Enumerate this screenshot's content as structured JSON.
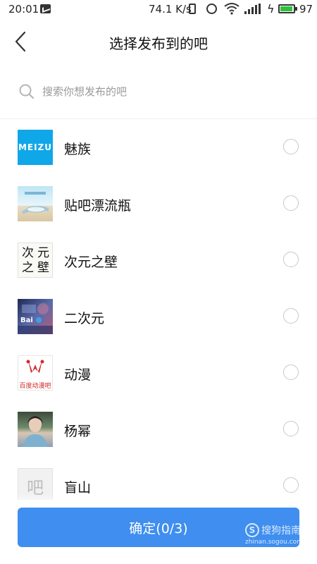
{
  "status_bar": {
    "time": "20:01",
    "net_speed": "74.1 K/s",
    "battery_level": 97,
    "battery_pct": "97",
    "icons": [
      "message-icon",
      "vibrate-icon",
      "alarm-icon",
      "wifi-icon",
      "signal-icon",
      "charging-icon",
      "battery-icon"
    ]
  },
  "header": {
    "title": "选择发布到的吧",
    "back_icon": "chevron-left-icon"
  },
  "search": {
    "placeholder": "搜索你想发布的吧",
    "value": ""
  },
  "forums": {
    "items": [
      {
        "name": "魅族",
        "selected": false,
        "thumb_text": "MEIZU",
        "thumb_color": "#10a7e8"
      },
      {
        "name": "贴吧漂流瓶",
        "selected": false,
        "thumb_text": "",
        "thumb_color": "#bfe6f5"
      },
      {
        "name": "次元之壁",
        "selected": false,
        "thumb_text": "次元之壁",
        "thumb_color": "#fafaf5"
      },
      {
        "name": "二次元",
        "selected": false,
        "thumb_text": "Bai",
        "thumb_color": "#1d2a55"
      },
      {
        "name": "动漫",
        "selected": false,
        "thumb_text": "百度动漫吧",
        "thumb_color": "#d42a2a"
      },
      {
        "name": "杨幂",
        "selected": false,
        "thumb_text": "",
        "thumb_color": "#6f8a6a"
      },
      {
        "name": "盲山",
        "selected": false,
        "thumb_text": "吧",
        "thumb_color": "#f1f1f1"
      }
    ]
  },
  "footer": {
    "confirm_label": "确定(0/3)",
    "accent_color": "#3f8ef0"
  },
  "watermark": {
    "brand": "搜狗指南",
    "url": "zhinan.sogou.com"
  }
}
